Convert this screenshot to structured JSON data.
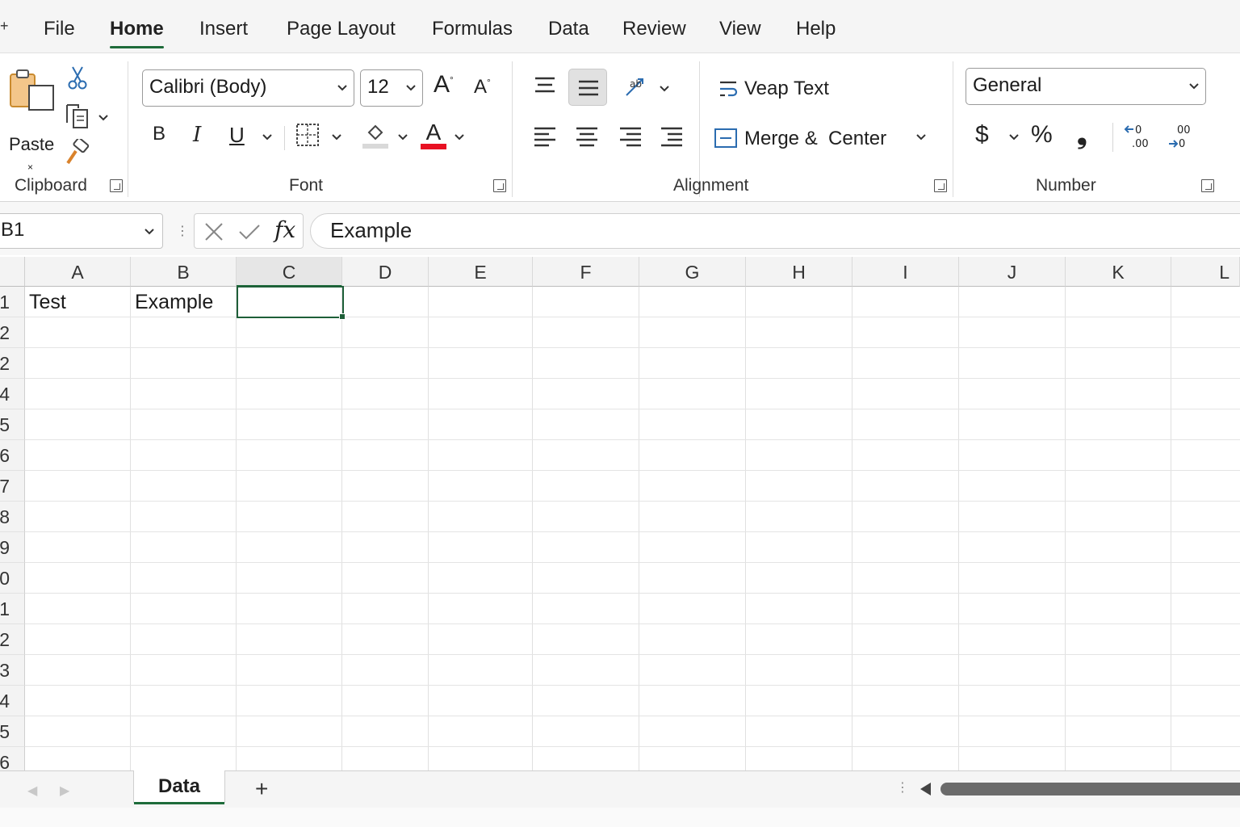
{
  "menu": {
    "tabs": [
      {
        "label": "File"
      },
      {
        "label": "Home"
      },
      {
        "label": "Insert"
      },
      {
        "label": "Page Layout"
      },
      {
        "label": "Formulas"
      },
      {
        "label": "Data"
      },
      {
        "label": "Review"
      },
      {
        "label": "View"
      },
      {
        "label": "Help"
      }
    ],
    "active": "Home"
  },
  "ribbon": {
    "clipboard": {
      "paste_label": "Paste",
      "paste_small": "×",
      "group_label": "Clipboard"
    },
    "font": {
      "font_name": "Calibri (Body)",
      "font_size": "12",
      "group_label": "Font",
      "bold": "B",
      "italic": "I",
      "underline": "U",
      "font_color_letter": "A"
    },
    "alignment": {
      "wrap_label": "Veap Text",
      "merge_label": "Merge &  Center",
      "group_label": "Alignment"
    },
    "number": {
      "format": "General",
      "currency": "$",
      "percent": "%",
      "comma": "❟",
      "group_label": "Number"
    }
  },
  "formula_bar": {
    "name_box": "B1",
    "fx": "fx",
    "content": "Example"
  },
  "grid": {
    "columns": [
      "A",
      "B",
      "C",
      "D",
      "E",
      "F",
      "G",
      "H",
      "I",
      "J",
      "K",
      "L"
    ],
    "selected_column": "C",
    "rows": [
      "1",
      "2",
      "2",
      "4",
      "5",
      "6",
      "7",
      "8",
      "9",
      "0",
      "1",
      "2",
      "3",
      "4",
      "5",
      "6"
    ],
    "cells": {
      "A1": "Test",
      "B1": "Example"
    }
  },
  "sheets": {
    "tabs": [
      {
        "label": "Data"
      }
    ],
    "add": "+"
  },
  "colors": {
    "accent": "#1e6b3a",
    "font_color_bar": "#e81123"
  }
}
